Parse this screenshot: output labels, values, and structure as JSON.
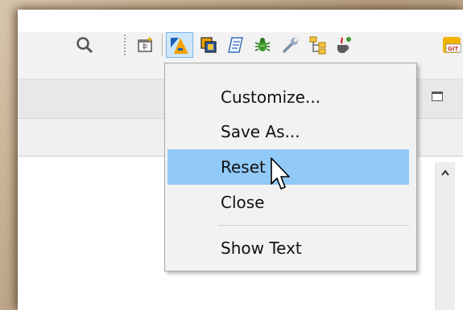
{
  "toolbar": {
    "icons": [
      "search-icon",
      "new-window-icon",
      "perspective-icon",
      "restore-icon",
      "script-icon",
      "debug-icon",
      "wrench-icon",
      "hierarchy-icon",
      "java-icon",
      "git-icon"
    ],
    "pressed_icon": "perspective-icon"
  },
  "menu": {
    "items": [
      {
        "label": "Customize..."
      },
      {
        "label": "Save As..."
      },
      {
        "label": "Reset"
      },
      {
        "label": "Close"
      },
      {
        "label": "Show Text"
      }
    ],
    "highlighted": "Reset",
    "highlight_color": "#91c9f7"
  },
  "git_badge": "GIT"
}
